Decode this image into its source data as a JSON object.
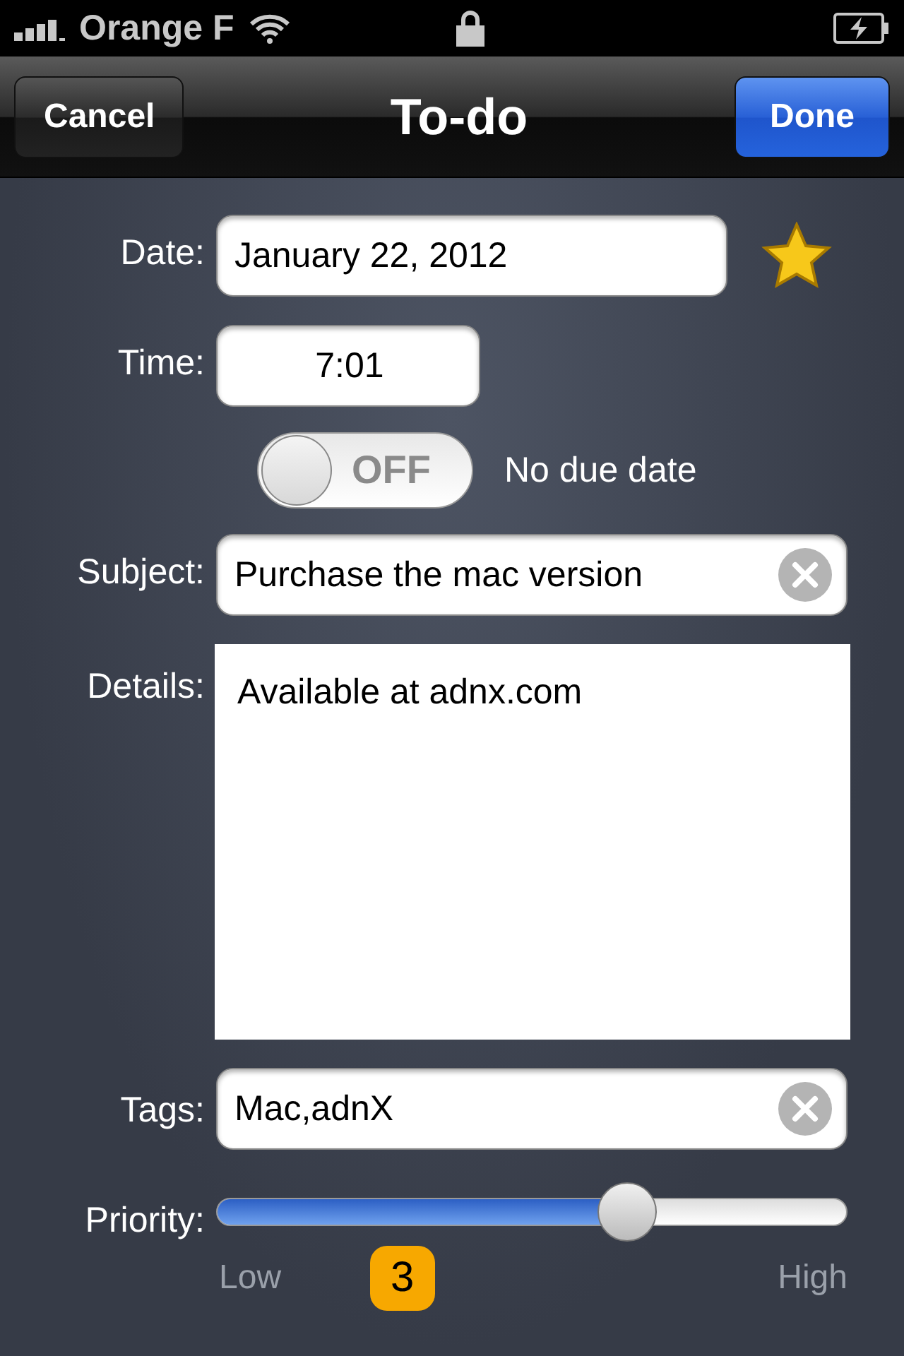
{
  "status_bar": {
    "carrier": "Orange F"
  },
  "nav": {
    "title": "To-do",
    "left_button": "Cancel",
    "right_button": "Done"
  },
  "date": {
    "label": "Date:",
    "value": "January 22, 2012",
    "starred": true
  },
  "time": {
    "label": "Time:",
    "value": "7:01"
  },
  "due_toggle": {
    "on": false,
    "state_text": "OFF",
    "label": "No due date"
  },
  "subject": {
    "label": "Subject:",
    "value": "Purchase the mac version"
  },
  "details": {
    "label": "Details:",
    "value": "Available at adnx.com"
  },
  "tags": {
    "label": "Tags:",
    "value": "Mac,adnX"
  },
  "priority": {
    "label": "Priority:",
    "level": 0.65,
    "low_label": "Low",
    "high_label": "High",
    "value": "3"
  }
}
